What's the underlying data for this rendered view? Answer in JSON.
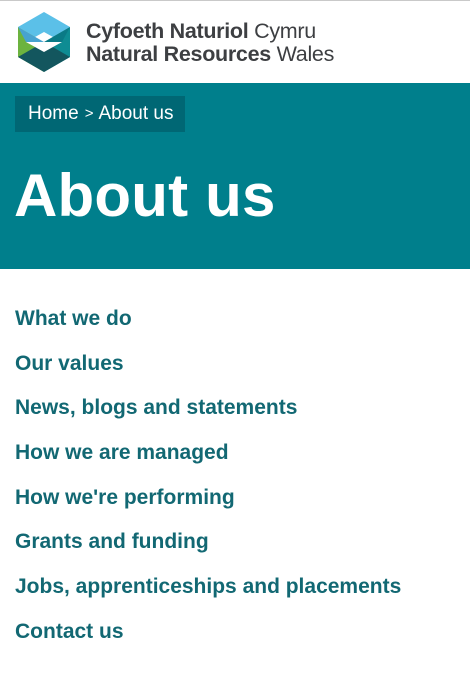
{
  "header": {
    "logo_line1_bold": "Cyfoeth Naturiol",
    "logo_line1_light": "Cymru",
    "logo_line2_bold": "Natural Resources",
    "logo_line2_light": "Wales",
    "logo_icon": "nrw-hexagon-logo-icon"
  },
  "breadcrumb": {
    "home": "Home",
    "separator": ">",
    "current": "About us"
  },
  "hero": {
    "title": "About us"
  },
  "nav": {
    "items": [
      {
        "label": "What we do"
      },
      {
        "label": "Our values"
      },
      {
        "label": "News, blogs and statements"
      },
      {
        "label": "How we are managed"
      },
      {
        "label": "How we're performing"
      },
      {
        "label": "Grants and funding"
      },
      {
        "label": "Jobs, apprenticeships and placements"
      },
      {
        "label": "Contact us"
      }
    ]
  },
  "colors": {
    "hero_bg": "#007f8c",
    "breadcrumb_bg": "#006774",
    "link": "#126873",
    "logo_text": "#3d3f42"
  }
}
